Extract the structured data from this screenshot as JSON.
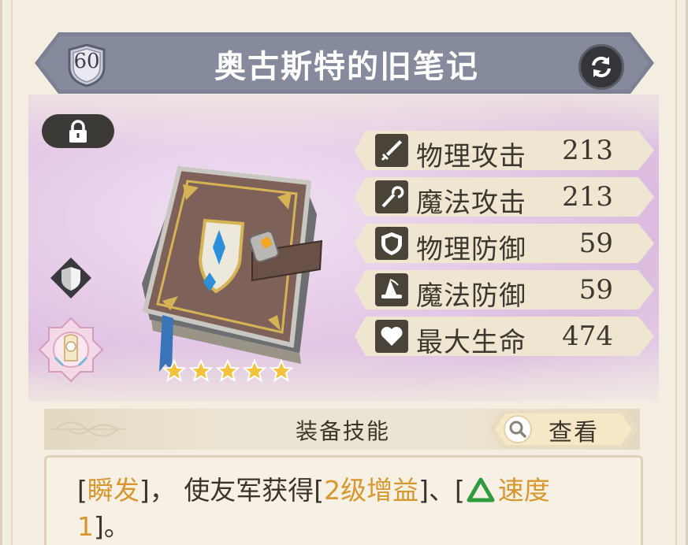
{
  "header": {
    "level": "60",
    "title": "奥古斯特的旧笔记"
  },
  "item": {
    "rarity_stars": 5,
    "icon": "old-notebook-icon"
  },
  "stats": [
    {
      "icon": "sword-icon",
      "label": "物理攻击",
      "value": "213"
    },
    {
      "icon": "staff-icon",
      "label": "魔法攻击",
      "value": "213"
    },
    {
      "icon": "shield-icon",
      "label": "物理防御",
      "value": "59"
    },
    {
      "icon": "wizard-hat-icon",
      "label": "魔法防御",
      "value": "59"
    },
    {
      "icon": "heart-icon",
      "label": "最大生命",
      "value": "474"
    }
  ],
  "skill": {
    "section_title": "装备技能",
    "view_label": "查看",
    "desc": {
      "b1": "[",
      "k1": "瞬发",
      "b2": "]， 使友军获得[",
      "k2": "2级增益",
      "b3": "]、[",
      "k3": "速度",
      "k4": "1",
      "b4": "]。"
    }
  },
  "colors": {
    "banner": "#858a9c",
    "highlight": "#d8962c",
    "buff_green": "#2f9a3e",
    "text": "#3d372e"
  }
}
